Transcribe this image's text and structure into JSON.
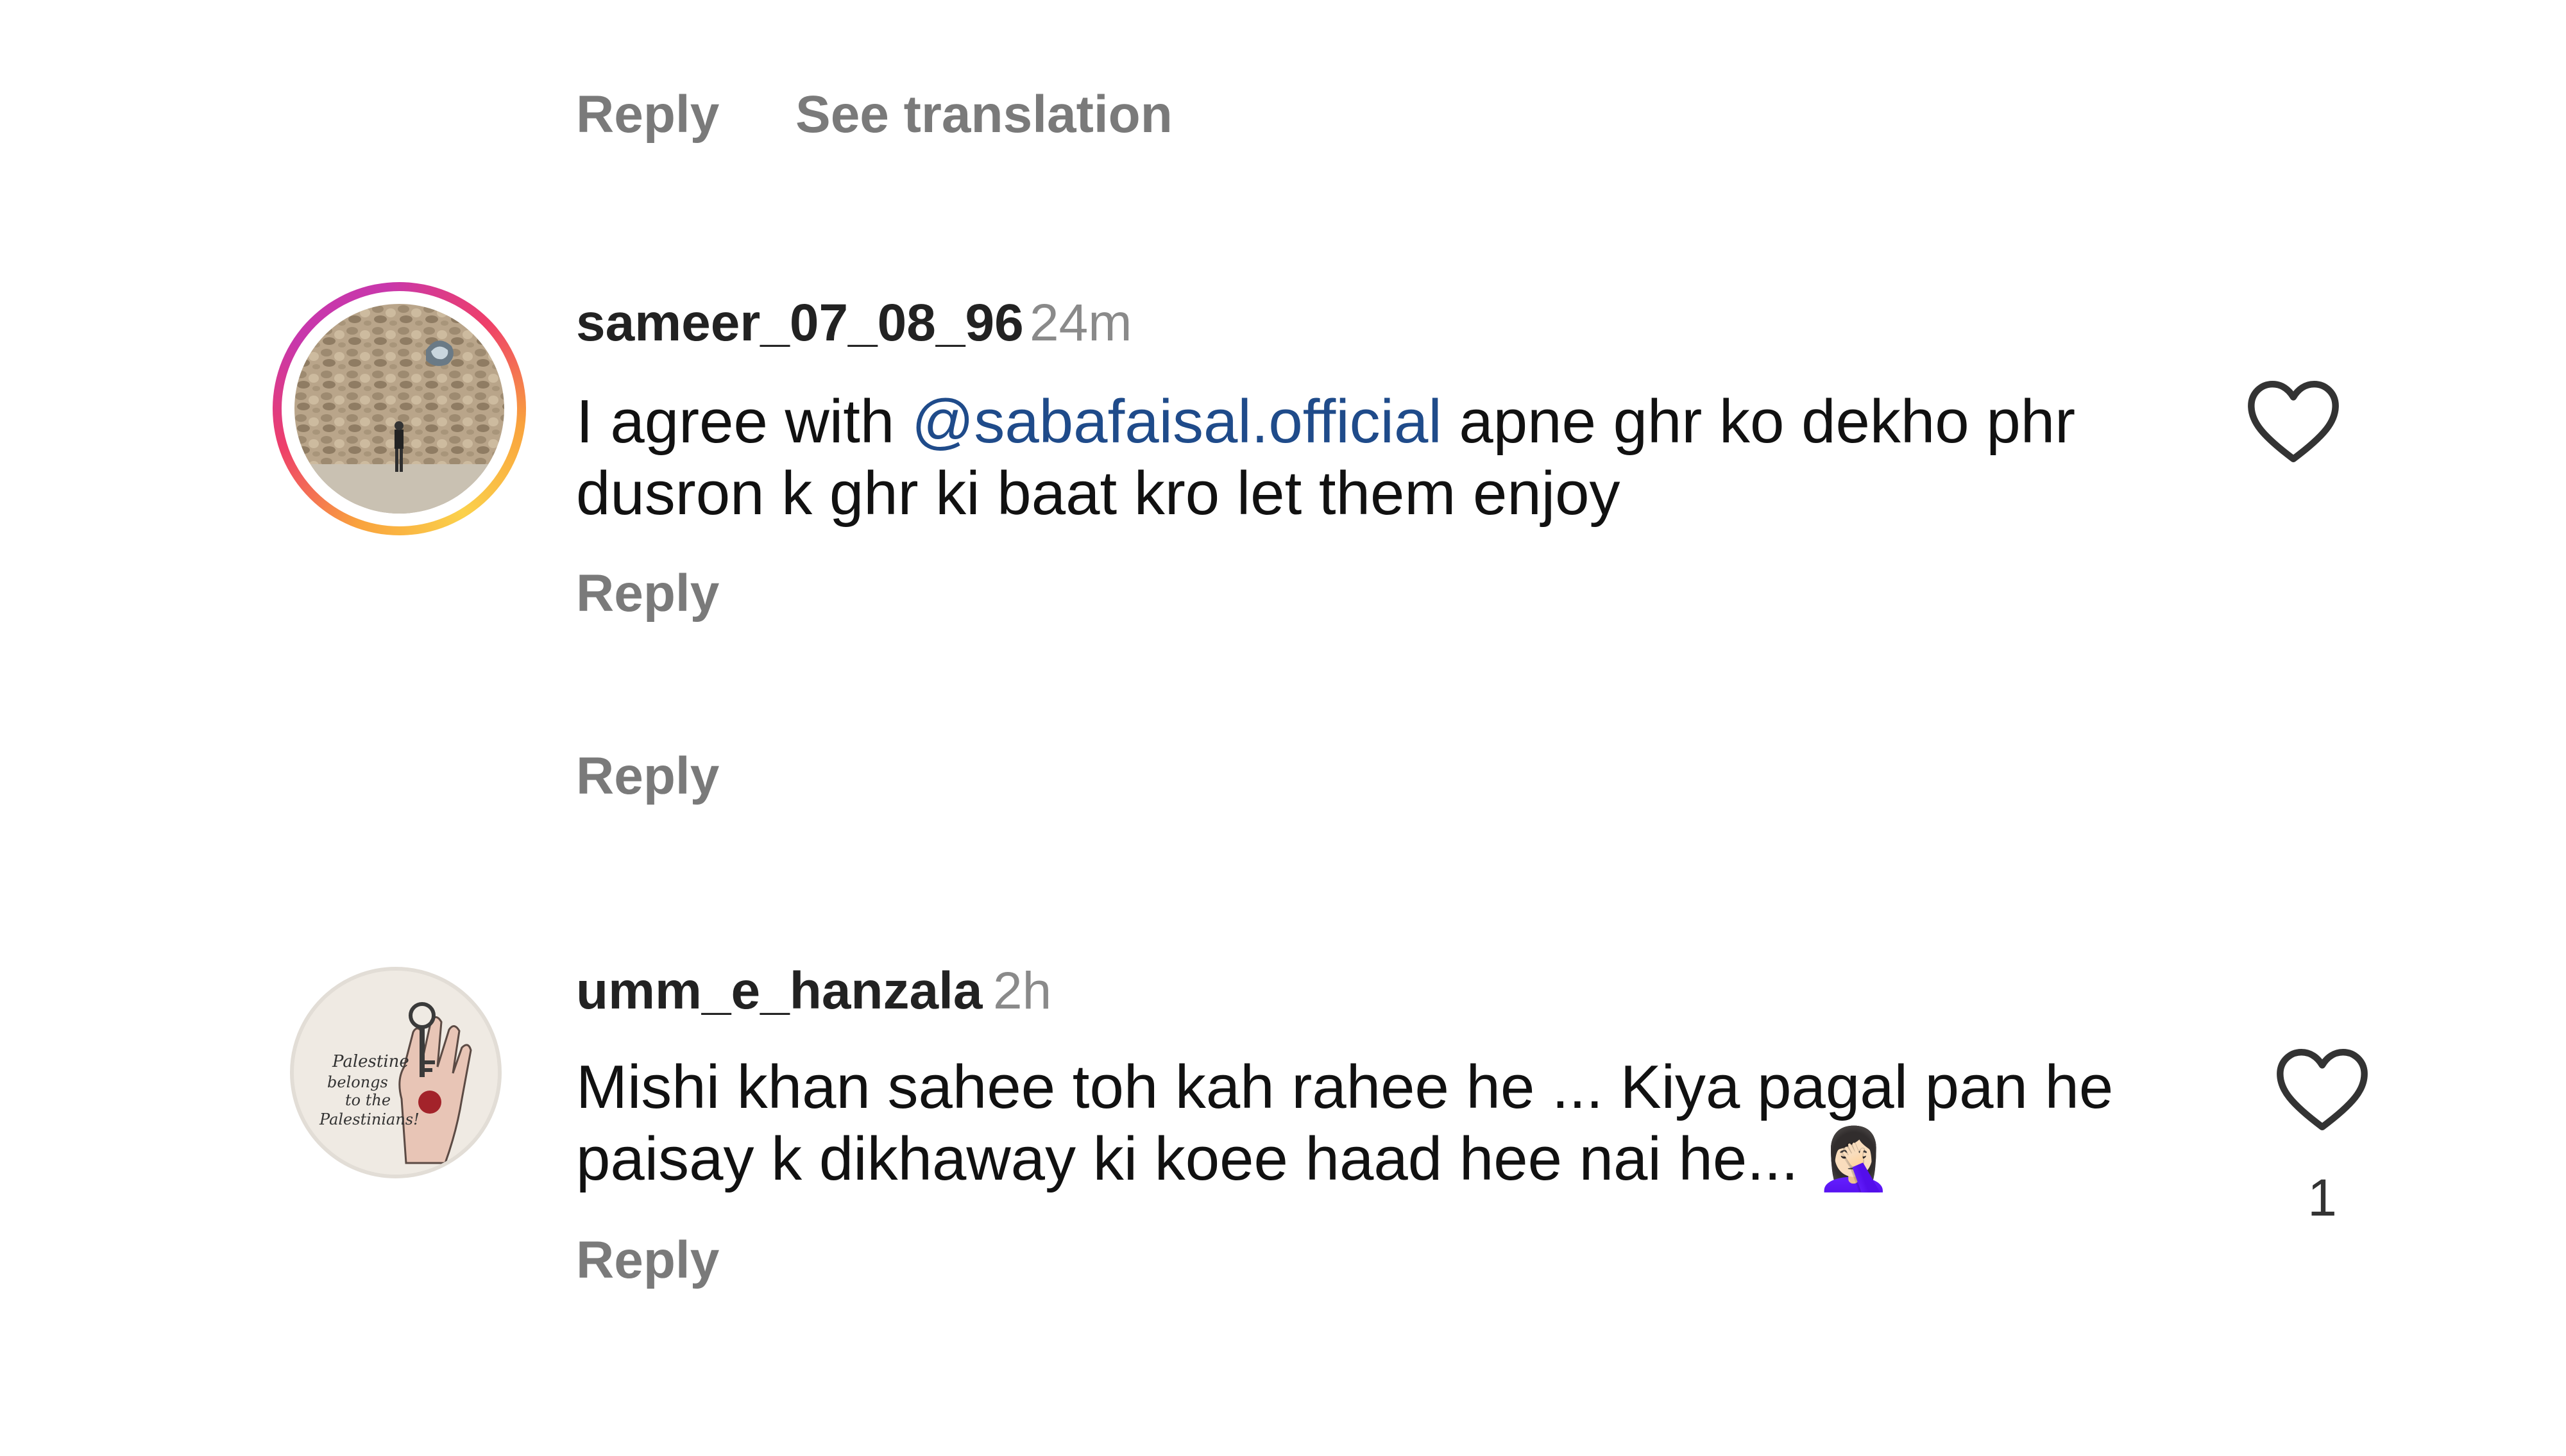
{
  "top_actions": {
    "reply_label": "Reply",
    "see_translation_label": "See translation"
  },
  "comments": [
    {
      "username": "sameer_07_08_96",
      "time": "24m",
      "text_before": "I agree with ",
      "mention": "@sabafaisal.official",
      "text_after": " apne ghr ko dekho phr dusron k ghr ki baat kro let them enjoy",
      "reply_label": "Reply",
      "avatar_icon": "wall-photo-avatar-icon",
      "like_icon": "heart-outline-icon"
    },
    {
      "reply_label": "Reply"
    },
    {
      "username": "umm_e_hanzala",
      "time": "2h",
      "text": "Mishi khan sahee toh kah rahee he ... Kiya pagal pan he paisay k dikhaway ki koee haad hee nai he...",
      "emoji": "🤦🏻‍♀️",
      "reply_label": "Reply",
      "like_count": "1",
      "avatar_icon": "palestine-key-hand-avatar-icon",
      "avatar_text": "Palestine belongs to the Palestinians!",
      "like_icon": "heart-outline-icon"
    }
  ],
  "colors": {
    "mention": "#1f4b8a",
    "secondary_text": "#7a7a7a",
    "story_ring": [
      "#f9a23d",
      "#ee3f6a",
      "#c837ab",
      "#fbd14b"
    ]
  }
}
